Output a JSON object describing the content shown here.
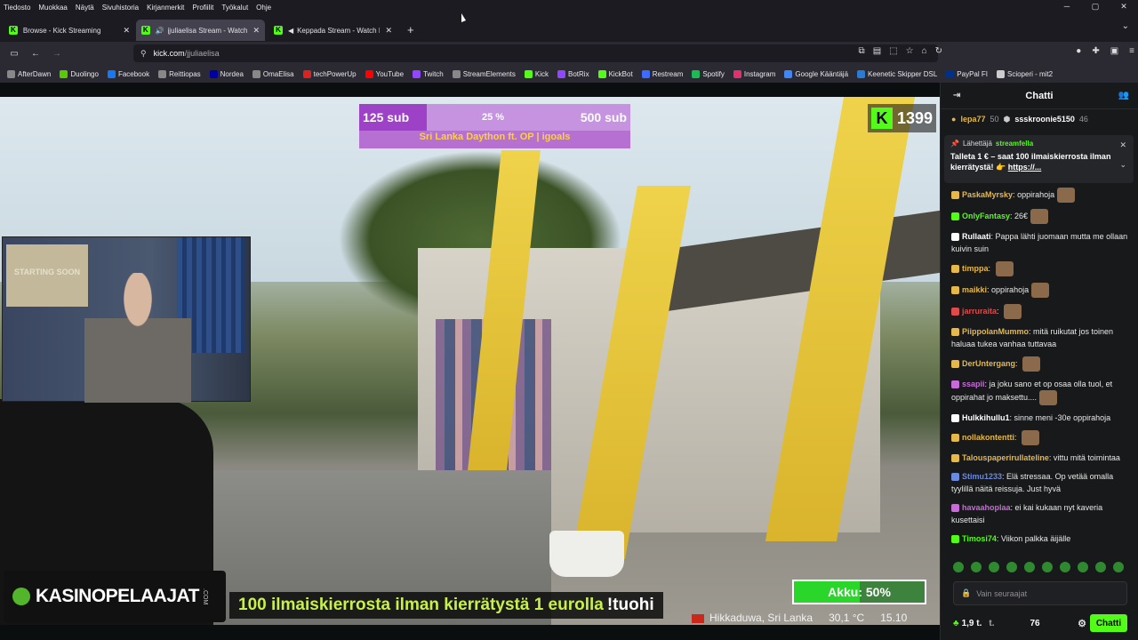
{
  "menubar": {
    "items": [
      "Tiedosto",
      "Muokkaa",
      "Näytä",
      "Sivuhistoria",
      "Kirjanmerkit",
      "Profiilit",
      "Työkalut",
      "Ohje"
    ]
  },
  "tabs": [
    {
      "title": "Browse - Kick Streaming",
      "active": false
    },
    {
      "title": "jjuliaelisa Stream - Watch Li",
      "active": true
    },
    {
      "title": "Keppada Stream - Watch Li",
      "active": false
    }
  ],
  "url": {
    "host": "kick.com",
    "path": "/jjuliaelisa"
  },
  "bookmarks": [
    {
      "label": "AfterDawn",
      "color": "#888888"
    },
    {
      "label": "Duolingo",
      "color": "#58cc02"
    },
    {
      "label": "Facebook",
      "color": "#1877f2"
    },
    {
      "label": "Reittiopas",
      "color": "#888888"
    },
    {
      "label": "Nordea",
      "color": "#0000a0"
    },
    {
      "label": "OmaElisa",
      "color": "#888888"
    },
    {
      "label": "techPowerUp",
      "color": "#d22"
    },
    {
      "label": "YouTube",
      "color": "#ff0000"
    },
    {
      "label": "Twitch",
      "color": "#9146ff"
    },
    {
      "label": "StreamElements",
      "color": "#888888"
    },
    {
      "label": "Kick",
      "color": "#53fc18"
    },
    {
      "label": "BotRix",
      "color": "#9146ff"
    },
    {
      "label": "KickBot",
      "color": "#53fc18"
    },
    {
      "label": "Restream",
      "color": "#3d6bff"
    },
    {
      "label": "Spotify",
      "color": "#1db954"
    },
    {
      "label": "Instagram",
      "color": "#e1306c"
    },
    {
      "label": "Google Kääntäjä",
      "color": "#4285f4"
    },
    {
      "label": "Keenetic Skipper DSL",
      "color": "#2a7bd4"
    },
    {
      "label": "PayPal FI",
      "color": "#003087"
    },
    {
      "label": "Scioperi - mit2",
      "color": "#cccccc"
    }
  ],
  "overlay": {
    "sub_left": "125 sub",
    "sub_percent": "25 %",
    "sub_percent_value": 25,
    "sub_right": "500 sub",
    "sub_title": "Sri Lanka Daython ft. OP | igoals",
    "kick_count": "1399",
    "webcam_poster": "STARTING SOON",
    "kasino_logo": "KASINOPELAAJAT",
    "kasino_com": ".COM",
    "promo_green": "100 ilmaiskierrosta ilman kierrätystä 1 eurolla",
    "promo_white": "!tuohi",
    "akku": "Akku: 50%",
    "akku_value": 50,
    "location": "Hikkaduwa, Sri Lanka",
    "temp": "30,1 °C",
    "time": "15.10"
  },
  "chat": {
    "title": "Chatti",
    "top_user1": "lepa77",
    "top_val1": "50",
    "top_user2": "ssskroonie5150",
    "top_val2": "46",
    "pinned_label": "Lähettäjä",
    "pinned_user": "streamfella",
    "pinned_text": "Talleta 1 € – saat 100 ilmaiskierrosta ilman kierrätystä! 👉",
    "pinned_link": "https://...",
    "messages": [
      {
        "user": "PaskaMyrsky",
        "color": "#e6b84a",
        "text": "oppirahoja",
        "emote": true
      },
      {
        "user": "OnlyFantasy",
        "color": "#53fc18",
        "text": "26€",
        "emote": true
      },
      {
        "user": "Rullaati",
        "color": "#ffffff",
        "text": "Pappa lähti juomaan mutta me ollaan kuivin suin",
        "emote": false
      },
      {
        "user": "timppa",
        "color": "#e6b84a",
        "text": "",
        "emote": true
      },
      {
        "user": "maikki",
        "color": "#e6b84a",
        "text": "oppirahoja",
        "emote": true
      },
      {
        "user": "jarruraita",
        "color": "#e04a4a",
        "text": "",
        "emote": true
      },
      {
        "user": "PiippolanMummo",
        "color": "#e6b84a",
        "text": "mitä ruikutat jos toinen haluaa tukea vanhaa tuttavaa",
        "emote": false
      },
      {
        "user": "DerUntergang",
        "color": "#e6b84a",
        "text": "",
        "emote": true
      },
      {
        "user": "ssapii",
        "color": "#c86ad8",
        "text": "ja joku sano et op osaa olla tuol, et oppirahat jo maksettu....",
        "emote": true
      },
      {
        "user": "Hulkkihullu1",
        "color": "#ffffff",
        "text": "sinne meni -30e oppirahoja",
        "emote": false
      },
      {
        "user": "nollakontentti",
        "color": "#e6b84a",
        "text": "",
        "emote": true
      },
      {
        "user": "Talouspaperirullateline",
        "color": "#e6b84a",
        "text": "vittu mitä toimintaa",
        "emote": false
      },
      {
        "user": "Stimu1233",
        "color": "#6a8adf",
        "text": "Elä stressaa. Op vetää omalla tyylillä näitä reissuja. Just hyvä",
        "emote": false
      },
      {
        "user": "havaahoplaa",
        "color": "#c86ad8",
        "text": "ei kai kukaan nyt kaveria kusettaisi",
        "emote": false
      },
      {
        "user": "Timosi74",
        "color": "#53fc18",
        "text": "Viikon palkka äijälle",
        "emote": false
      }
    ],
    "input_placeholder": "Vain seuraajat",
    "balance": "1,9 t.",
    "points": "76",
    "send_label": "Chatti"
  }
}
